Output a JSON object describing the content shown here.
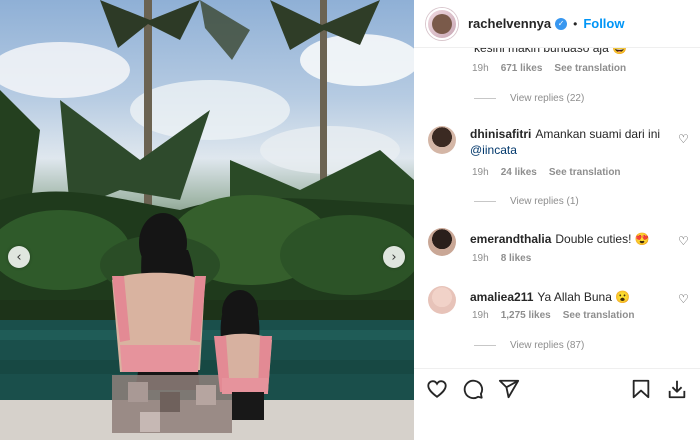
{
  "post": {
    "username": "rachelvennya",
    "follow_label": "Follow",
    "dot": "•",
    "verified_glyph": "✓"
  },
  "carousel": {
    "prev_glyph": "‹",
    "next_glyph": "›"
  },
  "comments": [
    {
      "text": "kesini makin bundaso aja 😅",
      "time": "19h",
      "likes": "671 likes",
      "translate": "See translation",
      "replies": "View replies (22)"
    },
    {
      "user": "dhinisafitri",
      "text": "Amankan suami dari ini",
      "mention": "@iincata",
      "time": "19h",
      "likes": "24 likes",
      "translate": "See translation",
      "replies": "View replies (1)"
    },
    {
      "user": "emerandthalia",
      "text": "Double cuties! 😍",
      "time": "19h",
      "likes": "8 likes"
    },
    {
      "user": "amaliea211",
      "text": "Ya Allah Buna 😮",
      "time": "19h",
      "likes": "1,275 likes",
      "translate": "See translation",
      "replies": "View replies (87)"
    }
  ],
  "icons": {
    "like": "heart-icon",
    "comment": "comment-icon",
    "share": "send-icon",
    "save": "bookmark-icon",
    "download": "download-icon"
  },
  "colors": {
    "follow": "#0095f6",
    "verified": "#3897f0",
    "mention": "#00376b",
    "meta": "#8e8e8e"
  }
}
